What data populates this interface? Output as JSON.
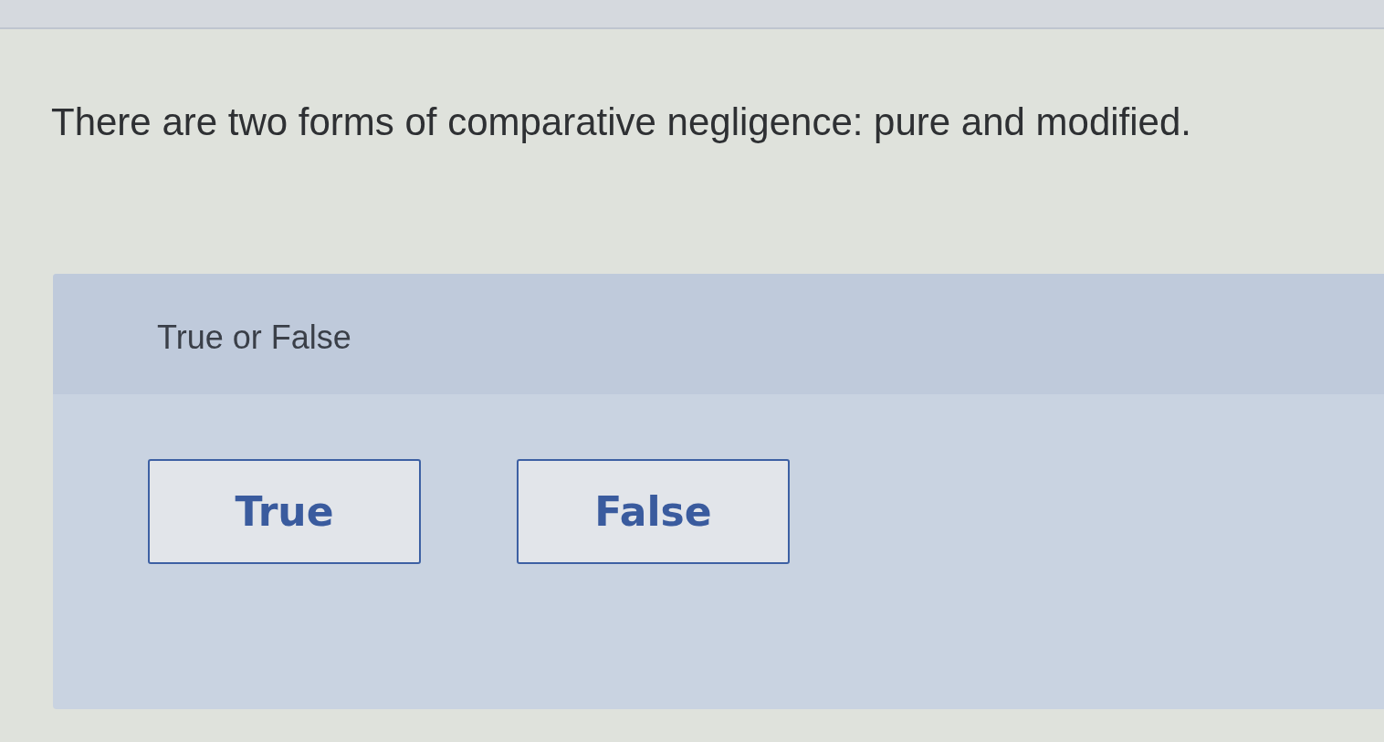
{
  "question": {
    "text": "There are two forms of comparative negligence: pure and modified."
  },
  "answer_panel": {
    "prompt": "True or False",
    "options": [
      {
        "label": "True",
        "selected": false
      },
      {
        "label": "False",
        "selected": false
      }
    ]
  }
}
